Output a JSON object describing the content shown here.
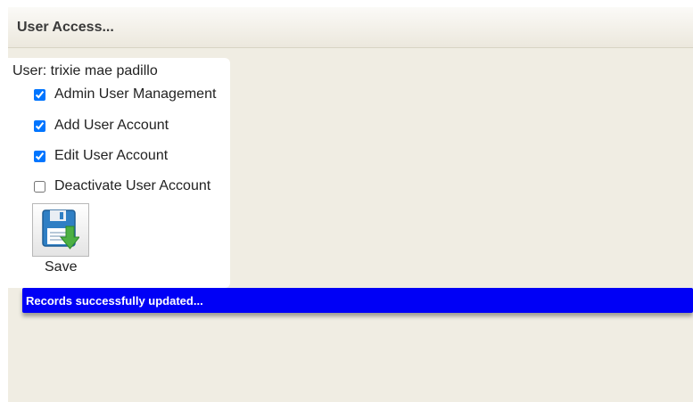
{
  "header": {
    "title": "User Access..."
  },
  "access": {
    "user_label": "User: trixie mae padillo",
    "permissions": [
      {
        "label": "Admin User Management",
        "checked": true
      },
      {
        "label": "Add User Account",
        "checked": true
      },
      {
        "label": "Edit User Account",
        "checked": true
      },
      {
        "label": "Deactivate User Account",
        "checked": false
      }
    ],
    "save_label": "Save",
    "save_icon": "floppy-disk-download-icon"
  },
  "status": {
    "message": "Records successfully updated..."
  },
  "colors": {
    "panel_background": "#f0ede3",
    "status_bar": "#0000f6",
    "status_text": "#ffffff"
  }
}
